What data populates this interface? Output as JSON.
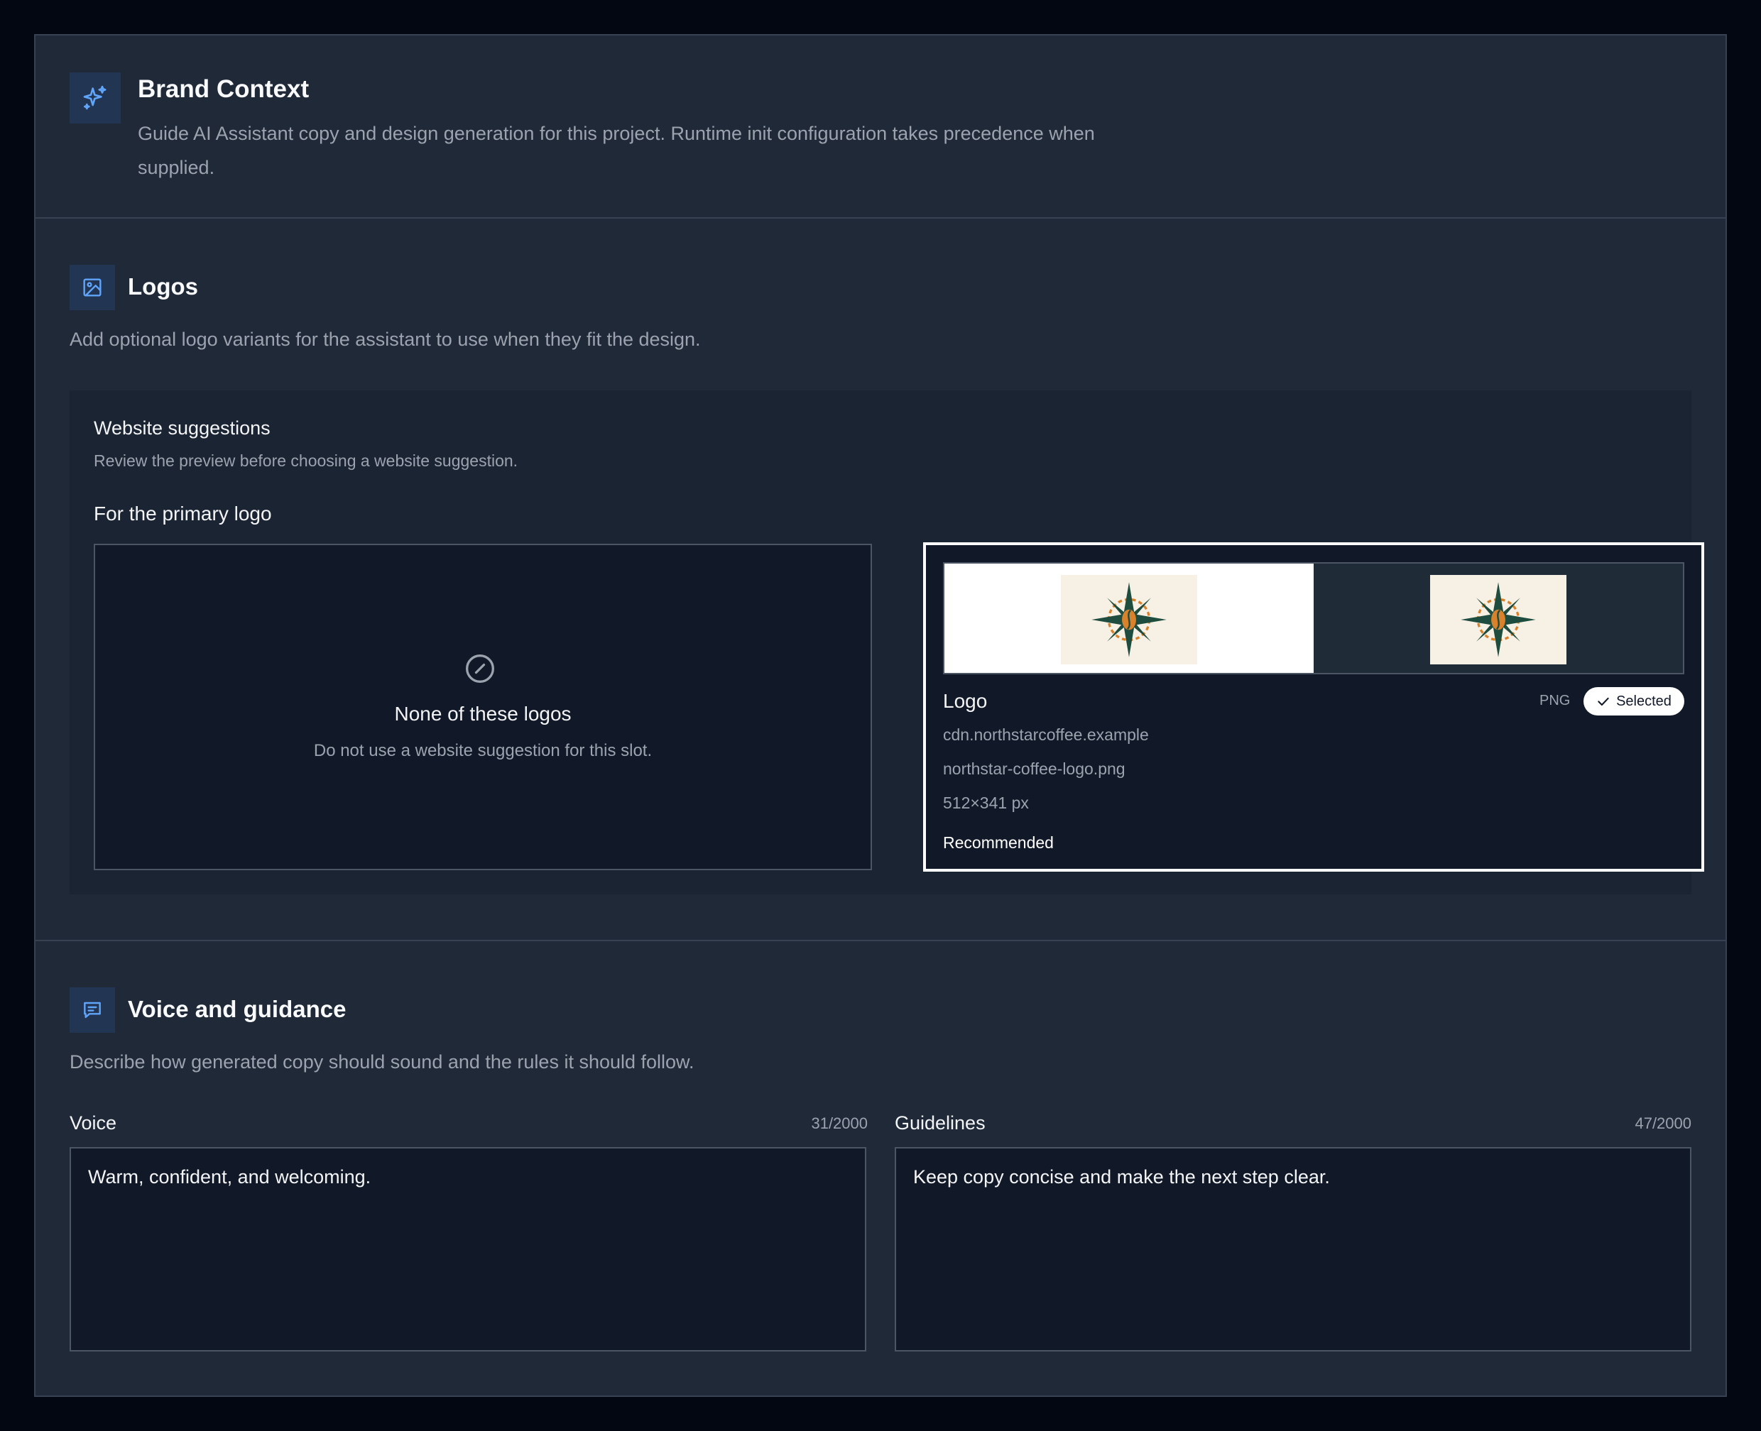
{
  "header": {
    "icon": "sparkles-icon",
    "title": "Brand Context",
    "description": "Guide AI Assistant copy and design generation for this project. Runtime init configuration takes precedence when supplied."
  },
  "logos": {
    "icon": "image-icon",
    "title": "Logos",
    "description": "Add optional logo variants for the assistant to use when they fit the design.",
    "suggestions": {
      "title": "Website suggestions",
      "subtitle": "Review the preview before choosing a website suggestion.",
      "slot_label": "For the primary logo",
      "none_option": {
        "title": "None of these logos",
        "description": "Do not use a website suggestion for this slot."
      },
      "selected_option": {
        "name": "Logo",
        "format": "PNG",
        "badge": "Selected",
        "domain": "cdn.northstarcoffee.example",
        "filename": "northstar-coffee-logo.png",
        "dimensions": "512×341 px",
        "recommendation": "Recommended"
      }
    }
  },
  "voice": {
    "icon": "message-icon",
    "title": "Voice and guidance",
    "description": "Describe how generated copy should sound and the rules it should follow.",
    "voice_field": {
      "label": "Voice",
      "counter": "31/2000",
      "value": "Warm, confident, and welcoming."
    },
    "guidelines_field": {
      "label": "Guidelines",
      "counter": "47/2000",
      "value": "Keep copy concise and make the next step clear."
    }
  },
  "colors": {
    "accent": "#60a5fa",
    "logo_green": "#1e4d3f",
    "logo_orange": "#d9822b",
    "logo_bg": "#f6f1e4"
  }
}
